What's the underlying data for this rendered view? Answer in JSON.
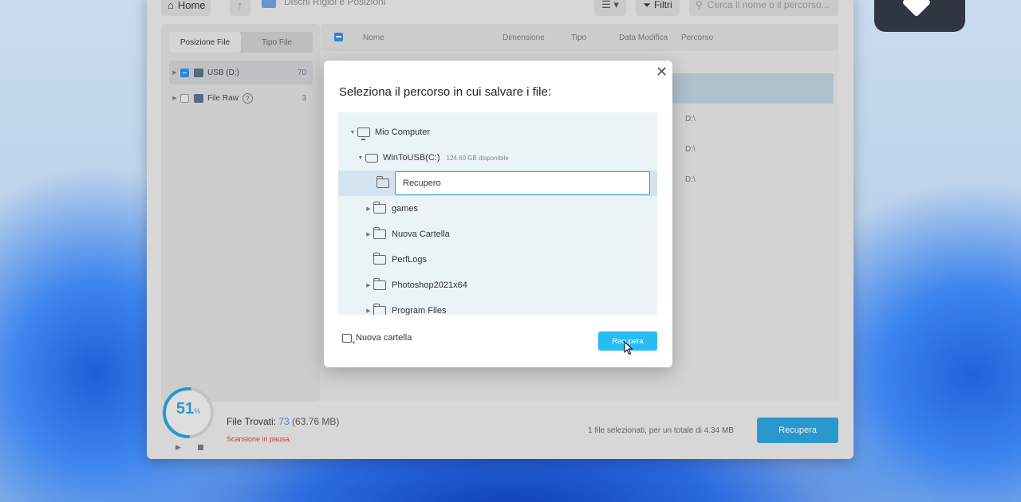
{
  "toolbar": {
    "home_label": "Home",
    "breadcrumb": "Dischi Rigidi e Posizioni",
    "filter_label": "Filtri",
    "search_placeholder": "Cerca il nome o il percorso..."
  },
  "sidebar": {
    "tabs": [
      "Posizione File",
      "Tipo File"
    ],
    "items": [
      {
        "label": "USB (D:)",
        "count": "70"
      },
      {
        "label": "File Raw",
        "count": "3"
      }
    ]
  },
  "list": {
    "columns": [
      "Nome",
      "Dimensione",
      "Tipo",
      "Data Modifica",
      "Percorso"
    ],
    "paths": [
      "D:\\",
      "D:\\",
      "D:\\"
    ]
  },
  "status": {
    "progress_value": "51",
    "progress_unit": "%",
    "progress_fraction": 0.51,
    "files_found_label": "File Trovati:",
    "files_found_count": "73",
    "files_found_size": "(63.76 MB)",
    "scan_status": "Scansione in pausa.",
    "selection_summary": "1 file selezionati, per un totale di 4.34 MB",
    "recover_label": "Recupera"
  },
  "dialog": {
    "title": "Seleziona il percorso in cui salvare i file:",
    "tree": {
      "root": "Mio Computer",
      "drive": "WinToUSB(C:)",
      "drive_available": "124.60 GB disponibile",
      "new_folder_value": "Recupero",
      "folders": [
        "games",
        "Nuova Cartella",
        "PerfLogs",
        "Photoshop2021x64",
        "Program Files"
      ]
    },
    "new_folder_label": "Nuova cartella",
    "recover_label": "Recupera"
  },
  "colors": {
    "accent": "#2aa0d9",
    "dialog_button": "#26bdf2",
    "paused_status": "#d0413a"
  }
}
